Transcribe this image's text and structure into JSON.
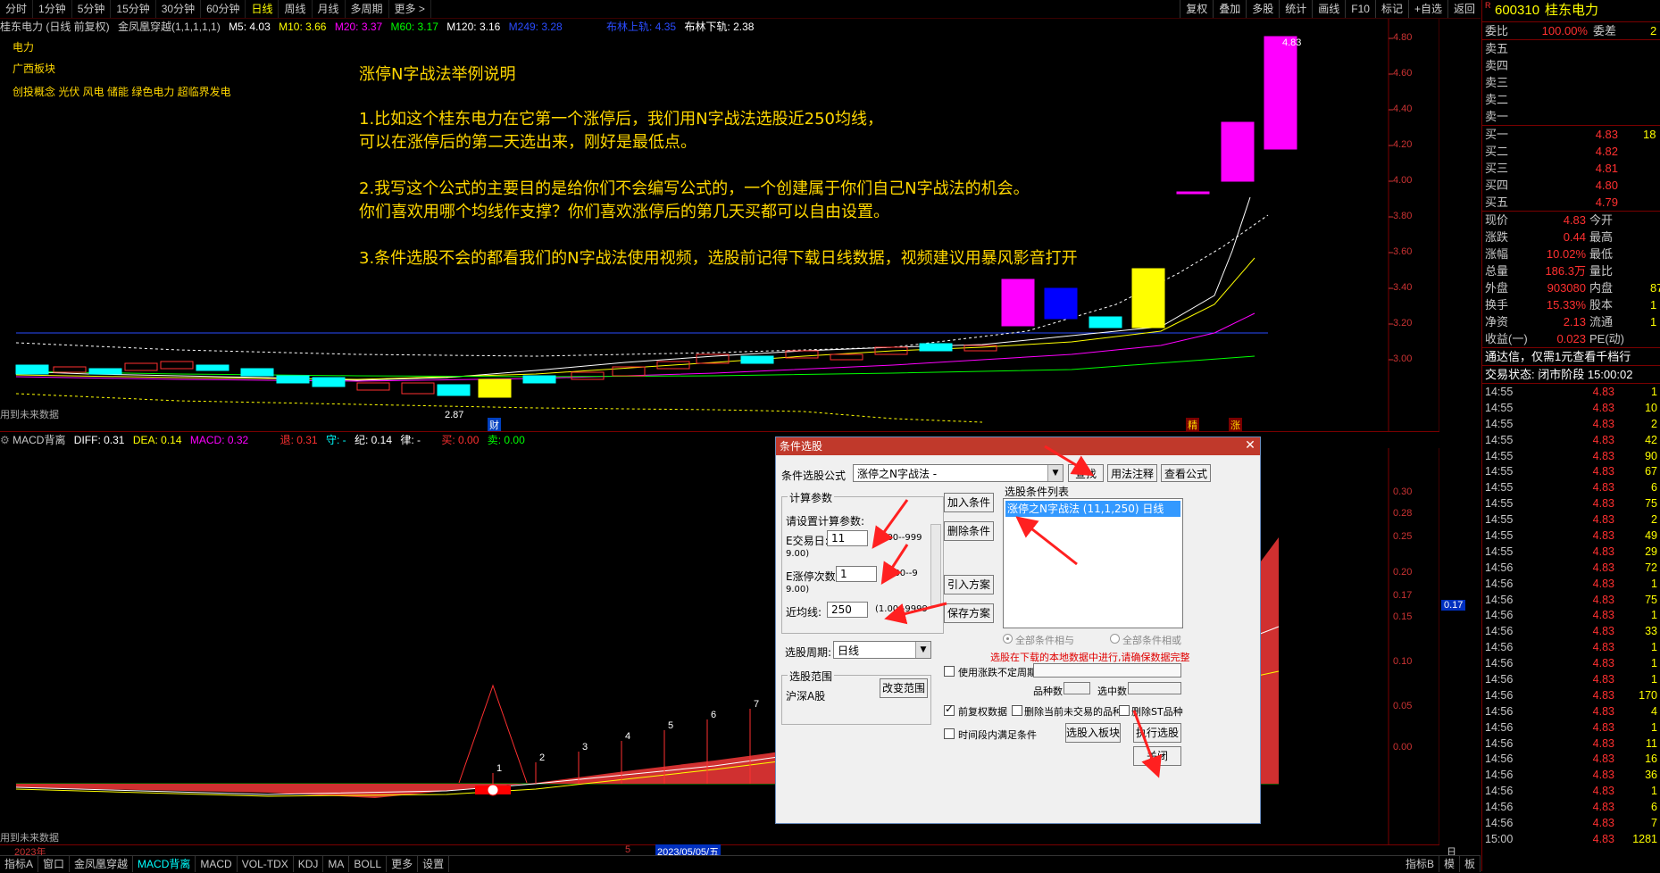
{
  "periods": [
    "分时",
    "1分钟",
    "5分钟",
    "15分钟",
    "30分钟",
    "60分钟",
    "日线",
    "周线",
    "月线",
    "多周期",
    "更多 >"
  ],
  "active_period": "日线",
  "toolbar_right": [
    "复权",
    "叠加",
    "多股",
    "统计",
    "画线",
    "F10",
    "标记",
    "+自选",
    "返回"
  ],
  "legend": {
    "stock": "桂东电力 (日线 前复权)",
    "indicator": "金凤凰穿越(1,1,1,1,1)",
    "ma5": "M5: 4.03",
    "ma10": "M10: 3.66",
    "ma20": "M20: 3.37",
    "ma60": "M60: 3.17",
    "ma120": "M120: 3.16",
    "ma250": "M249: 3.28",
    "boll_up": "布林上轨: 4.35",
    "boll_down": "布林下轨: 2.38"
  },
  "tags": [
    "电力",
    "广西板块",
    "创投概念 光伏 风电 储能 绿色电力 超临界发电"
  ],
  "annotation": {
    "title": "涨停N字战法举例说明",
    "p1a": "1.比如这个桂东电力在它第一个涨停后，我们用N字战法选股近250均线，",
    "p1b": "可以在涨停后的第二天选出来，刚好是最低点。",
    "p2a": "2.我写这个公式的主要目的是给你们不会编写公式的，一个创建属于你们自己N字战法的机会。",
    "p2b": "你们喜欢用哪个均线作支撑？你们喜欢涨停后的第几天买都可以自由设置。",
    "p3": "3.条件选股不会的都看我们的N字战法使用视频，选股前记得下载日线数据，视频建议用暴风影音打开"
  },
  "price_axis": [
    "4.80",
    "4.60",
    "4.40",
    "4.20",
    "4.00",
    "3.80",
    "3.60",
    "3.40",
    "3.20",
    "3.00"
  ],
  "macd_axis": [
    "0.30",
    "0.28",
    "0.25",
    "0.20",
    "0.17",
    "0.15",
    "0.10",
    "0.05",
    "0.00"
  ],
  "macd_current": "0.17",
  "kline_labels": {
    "low": "2.87",
    "high": "4.83",
    "future": "用到未来数据",
    "cai": "财",
    "jing": "精",
    "zhang": "涨"
  },
  "macd_legend": {
    "name": "MACD背离",
    "diff": "DIFF: 0.31",
    "dea": "DEA: 0.14",
    "macd": "MACD: 0.32",
    "a": "退: 0.31",
    "b": "守: -",
    "c": "纪: 0.14",
    "d": "律: -",
    "e": "买: 0.00",
    "f": "卖: 0.00"
  },
  "macd_nums": [
    "1",
    "2",
    "3",
    "4",
    "5",
    "6",
    "7"
  ],
  "date_axis": {
    "year": "2023年",
    "five": "5",
    "date": "2023/05/05/五",
    "period": "日线"
  },
  "bottom_tabs": [
    "指标A",
    "窗口",
    "金凤凰穿越",
    "MACD背离",
    "MACD",
    "VOL-TDX",
    "KDJ",
    "MA",
    "BOLL",
    "更多",
    "设置"
  ],
  "bottom_active": "MACD背离",
  "bottom_right": [
    "指标B",
    "模",
    "板"
  ],
  "rpanel": {
    "code": "600310",
    "name": "桂东电力",
    "r": "R",
    "weibi": "委比",
    "weibi_v": "100.00%",
    "weicha": "委差",
    "weicha_v": "2",
    "sells": [
      {
        "l": "卖五",
        "p": "",
        "v": ""
      },
      {
        "l": "卖四",
        "p": "",
        "v": ""
      },
      {
        "l": "卖三",
        "p": "",
        "v": ""
      },
      {
        "l": "卖二",
        "p": "",
        "v": ""
      },
      {
        "l": "卖一",
        "p": "",
        "v": ""
      }
    ],
    "buys": [
      {
        "l": "买一",
        "p": "4.83",
        "v": "18"
      },
      {
        "l": "买二",
        "p": "4.82",
        "v": ""
      },
      {
        "l": "买三",
        "p": "4.81",
        "v": ""
      },
      {
        "l": "买四",
        "p": "4.80",
        "v": ""
      },
      {
        "l": "买五",
        "p": "4.79",
        "v": ""
      }
    ],
    "stats": [
      {
        "l": "现价",
        "v": "4.83",
        "l2": "今开"
      },
      {
        "l": "涨跌",
        "v": "0.44",
        "l2": "最高"
      },
      {
        "l": "涨幅",
        "v": "10.02%",
        "l2": "最低"
      },
      {
        "l": "总量",
        "v": "186.3万",
        "l2": "量比"
      },
      {
        "l": "外盘",
        "v": "903080",
        "l2": "内盘",
        "v2": "87"
      },
      {
        "l": "换手",
        "v": "15.33%",
        "l2": "股本",
        "v2": "1"
      },
      {
        "l": "净资",
        "v": "2.13",
        "l2": "流通",
        "v2": "1"
      },
      {
        "l": "收益(一)",
        "v": "0.023",
        "l2": "PE(动)"
      }
    ],
    "notice": "通达信，仅需1元查看千档行",
    "trade_state": "交易状态: 闭市阶段 15:00:02",
    "ticks": [
      {
        "t": "14:55",
        "p": "4.83",
        "v": "1"
      },
      {
        "t": "14:55",
        "p": "4.83",
        "v": "10"
      },
      {
        "t": "14:55",
        "p": "4.83",
        "v": "2"
      },
      {
        "t": "14:55",
        "p": "4.83",
        "v": "42"
      },
      {
        "t": "14:55",
        "p": "4.83",
        "v": "90"
      },
      {
        "t": "14:55",
        "p": "4.83",
        "v": "67"
      },
      {
        "t": "14:55",
        "p": "4.83",
        "v": "6"
      },
      {
        "t": "14:55",
        "p": "4.83",
        "v": "75"
      },
      {
        "t": "14:55",
        "p": "4.83",
        "v": "2"
      },
      {
        "t": "14:55",
        "p": "4.83",
        "v": "49"
      },
      {
        "t": "14:55",
        "p": "4.83",
        "v": "29"
      },
      {
        "t": "14:56",
        "p": "4.83",
        "v": "72"
      },
      {
        "t": "14:56",
        "p": "4.83",
        "v": "1"
      },
      {
        "t": "14:56",
        "p": "4.83",
        "v": "75"
      },
      {
        "t": "14:56",
        "p": "4.83",
        "v": "1"
      },
      {
        "t": "14:56",
        "p": "4.83",
        "v": "33"
      },
      {
        "t": "14:56",
        "p": "4.83",
        "v": "1"
      },
      {
        "t": "14:56",
        "p": "4.83",
        "v": "1"
      },
      {
        "t": "14:56",
        "p": "4.83",
        "v": "1"
      },
      {
        "t": "14:56",
        "p": "4.83",
        "v": "170"
      },
      {
        "t": "14:56",
        "p": "4.83",
        "v": "4"
      },
      {
        "t": "14:56",
        "p": "4.83",
        "v": "1"
      },
      {
        "t": "14:56",
        "p": "4.83",
        "v": "11"
      },
      {
        "t": "14:56",
        "p": "4.83",
        "v": "16"
      },
      {
        "t": "14:56",
        "p": "4.83",
        "v": "36"
      },
      {
        "t": "14:56",
        "p": "4.83",
        "v": "1"
      },
      {
        "t": "14:56",
        "p": "4.83",
        "v": "6"
      },
      {
        "t": "14:56",
        "p": "4.83",
        "v": "7"
      },
      {
        "t": "15:00",
        "p": "4.83",
        "v": "1281"
      }
    ]
  },
  "dialog": {
    "title": "条件选股",
    "formula_label": "条件选股公式",
    "formula_value": "涨停之N字战法 -",
    "btn_find": "查找",
    "btn_usage": "用法注释",
    "btn_view": "查看公式",
    "calc_group": "计算参数",
    "calc_hint": "请设置计算参数:",
    "p1_label": "E交易日:",
    "p1_value": "11",
    "p1_range": "(1.00--999",
    "p1_range2": "9.00)",
    "p2_label": "E涨停次数:",
    "p2_value": "1",
    "p2_range": "(1.00--9",
    "p2_range2": "9.00)",
    "p3_label": "近均线:",
    "p3_value": "250",
    "p3_range": "(1.00--9999",
    "period_label": "选股周期:",
    "period_value": "日线",
    "range_group": "选股范围",
    "range_value": "沪深A股",
    "btn_change": "改变范围",
    "btn_add": "加入条件",
    "btn_del": "删除条件",
    "btn_import": "引入方案",
    "btn_save": "保存方案",
    "list_label": "选股条件列表",
    "list_item": "涨停之N字战法 (11,1,250) 日线",
    "radio_and": "全部条件相与",
    "radio_or": "全部条件相或",
    "warn": "选股在下载的本地数据中进行,请确保数据完整",
    "chk_var": "使用涨跌不定周期",
    "count_label": "品种数",
    "select_label": "选中数",
    "chk_fq": "前复权数据",
    "chk_rm": "删除当前未交易的品种",
    "chk_st": "删除ST品种",
    "chk_time": "时间段内满足条件",
    "btn_toblock": "选股入板块",
    "btn_exec": "执行选股",
    "btn_close": "关闭"
  }
}
